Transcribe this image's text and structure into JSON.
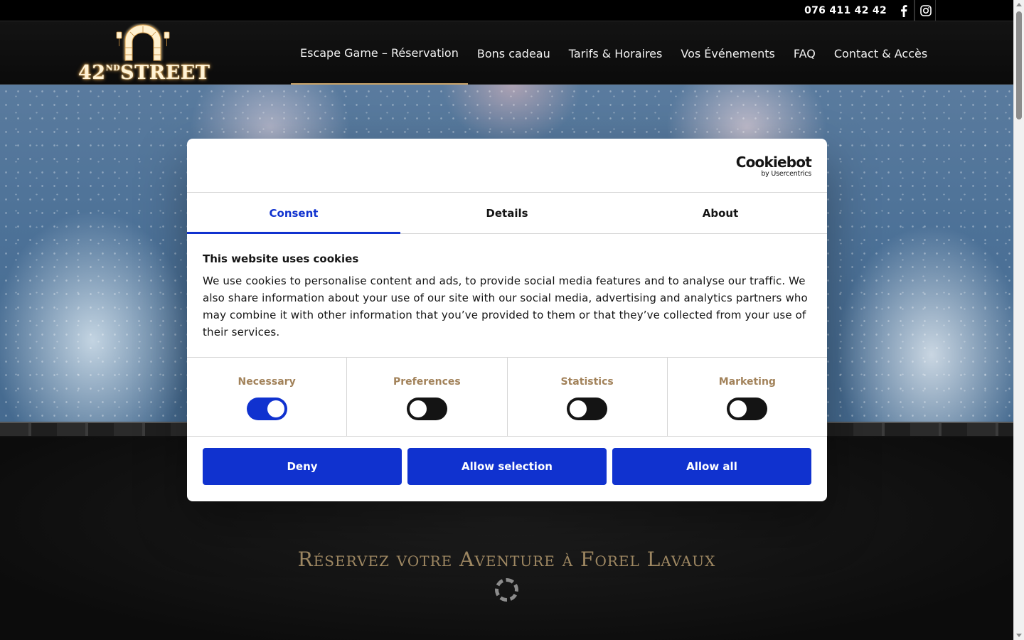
{
  "topbar": {
    "phone": "076 411 42 42",
    "social": [
      {
        "icon": "facebook-icon"
      },
      {
        "icon": "instagram-icon"
      }
    ]
  },
  "header": {
    "logo_text": "42",
    "logo_sup": "ND",
    "logo_word": "STREET",
    "nav": [
      {
        "label": "Escape Game – Réservation",
        "active": true
      },
      {
        "label": "Bons cadeau"
      },
      {
        "label": "Tarifs & Horaires"
      },
      {
        "label": "Vos Événements"
      },
      {
        "label": "FAQ"
      },
      {
        "label": "Contact & Accès"
      }
    ]
  },
  "main": {
    "section_title": "Réservez votre Aventure à Forel Lavaux"
  },
  "cookie_dialog": {
    "brand": "Cookiebot",
    "brand_by": "by Usercentrics",
    "tabs": [
      {
        "label": "Consent",
        "active": true
      },
      {
        "label": "Details"
      },
      {
        "label": "About"
      }
    ],
    "heading": "This website uses cookies",
    "text": "We use cookies to personalise content and ads, to provide social media features and to analyse our traffic. We also share information about your use of our site with our social media, advertising and analytics partners who may combine it with other information that you’ve provided to them or that they’ve collected from your use of their services.",
    "toggles": [
      {
        "label": "Necessary",
        "on": true
      },
      {
        "label": "Preferences",
        "on": false
      },
      {
        "label": "Statistics",
        "on": false
      },
      {
        "label": "Marketing",
        "on": false
      }
    ],
    "buttons": {
      "deny": "Deny",
      "allow_selection": "Allow selection",
      "allow_all": "Allow all"
    }
  },
  "colors": {
    "accent_blue": "#1032cf",
    "toggle_label": "#a2825a",
    "gold_title": "#a18a64"
  }
}
